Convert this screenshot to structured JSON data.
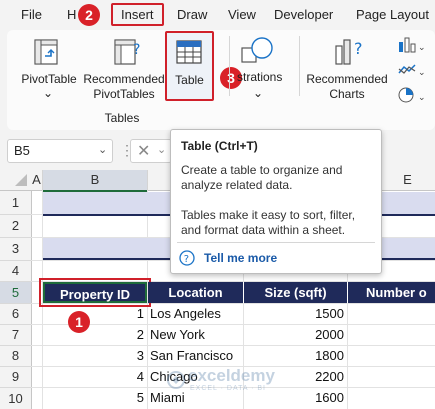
{
  "menu": {
    "file": "File",
    "home": "H",
    "insert": "Insert",
    "draw": "Draw",
    "view": "View",
    "developer": "Developer",
    "page_layout": "Page Layout"
  },
  "steps": {
    "one": "1",
    "two": "2",
    "three": "3"
  },
  "ribbon": {
    "pivottable": "PivotTable",
    "recommended_pivottables_1": "Recommended",
    "recommended_pivottables_2": "PivotTables",
    "table": "Table",
    "illustrations": "strations",
    "recommended_charts_1": "Recommended",
    "recommended_charts_2": "Charts",
    "group_tables": "Tables"
  },
  "namebox": {
    "value": "B5"
  },
  "tooltip": {
    "title": "Table (Ctrl+T)",
    "line1": "Create a table to organize and",
    "line2": "analyze related data.",
    "line3": "Tables make it easy to sort, filter,",
    "line4": "and format data within a sheet.",
    "link": "Tell me more"
  },
  "columns": [
    "A",
    "B",
    "E"
  ],
  "rows": [
    "1",
    "2",
    "3",
    "4",
    "5",
    "6",
    "7",
    "8",
    "9",
    "10"
  ],
  "table": {
    "headers": [
      "Property ID",
      "Location",
      "Size (sqft)",
      "Number o"
    ],
    "rows": [
      {
        "id": "1",
        "location": "Los Angeles",
        "size": "1500"
      },
      {
        "id": "2",
        "location": "New York",
        "size": "2000"
      },
      {
        "id": "3",
        "location": "San Francisco",
        "size": "1800"
      },
      {
        "id": "4",
        "location": "Chicago",
        "size": "2200"
      },
      {
        "id": "5",
        "location": "Miami",
        "size": "1600"
      }
    ]
  },
  "watermark": {
    "name": "exceldemy",
    "tagline": "EXCEL · DATA · BI"
  },
  "colors": {
    "header_bg": "#1f2a5a",
    "band": "#d9dcef",
    "accent_red": "#d92128"
  }
}
